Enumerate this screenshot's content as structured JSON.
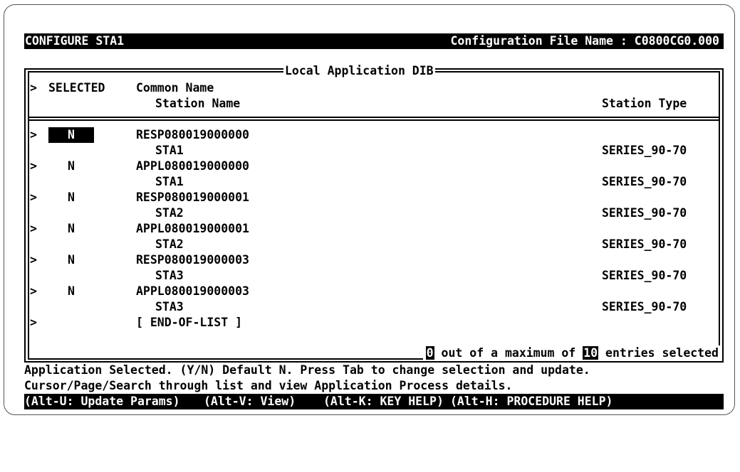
{
  "header": {
    "title": "CONFIGURE STA1",
    "config_file": "Configuration File Name : C0800CG0.000"
  },
  "panel": {
    "title": "Local Application DIB",
    "col_marker": ">",
    "col_selected": "SELECTED",
    "col_common_name": "Common Name",
    "col_station_name": "Station Name",
    "col_station_type": "Station Type"
  },
  "rows": [
    {
      "marker": ">",
      "selected": "N",
      "common": "RESP080019000000",
      "station": "STA1",
      "type": "SERIES_90-70"
    },
    {
      "marker": ">",
      "selected": "N",
      "common": "APPL080019000000",
      "station": "STA1",
      "type": "SERIES_90-70"
    },
    {
      "marker": ">",
      "selected": "N",
      "common": "RESP080019000001",
      "station": "STA2",
      "type": "SERIES_90-70"
    },
    {
      "marker": ">",
      "selected": "N",
      "common": "APPL080019000001",
      "station": "STA2",
      "type": "SERIES_90-70"
    },
    {
      "marker": ">",
      "selected": "N",
      "common": "RESP080019000003",
      "station": "STA3",
      "type": "SERIES_90-70"
    },
    {
      "marker": ">",
      "selected": "N",
      "common": "APPL080019000003",
      "station": "STA3",
      "type": "SERIES_90-70"
    }
  ],
  "end_of_list": {
    "marker": ">",
    "label": "[ END-OF-LIST ]"
  },
  "selection_count": {
    "selected": "0",
    "text_mid": " out of a maximum of ",
    "max": "10",
    "text_end": " entries selected"
  },
  "help": {
    "line1": "Application Selected. (Y/N) Default N. Press Tab to change selection and update.",
    "line2": "Cursor/Page/Search through list and view Application Process details."
  },
  "keys": {
    "update": "(Alt-U: Update Params)",
    "view": "(Alt-V: View)",
    "key_help": "(Alt-K: KEY HELP)",
    "proc_help": "(Alt-H: PROCEDURE HELP)"
  }
}
